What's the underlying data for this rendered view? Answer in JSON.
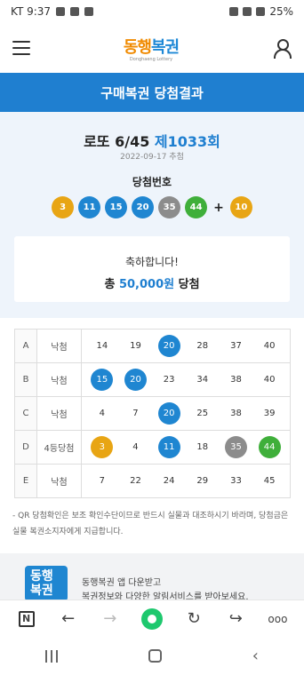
{
  "status_bar": {
    "carrier_time": "KT 9:37",
    "battery": "25%"
  },
  "header": {
    "logo_text_orange": "동행",
    "logo_text_blue": "복권",
    "logo_sub": "Donghaeng Lottery"
  },
  "page_title": "구매복권 당첨결과",
  "result": {
    "game": "로또 6/45",
    "round": "제1033회",
    "draw_date": "2022-09-17 추첨",
    "winning_label": "당첨번호",
    "winning_numbers": [
      {
        "n": "3",
        "color": "#e8a514"
      },
      {
        "n": "11",
        "color": "#1f86d1"
      },
      {
        "n": "15",
        "color": "#1f86d1"
      },
      {
        "n": "20",
        "color": "#1f86d1"
      },
      {
        "n": "35",
        "color": "#8c8c8c"
      },
      {
        "n": "44",
        "color": "#3faf3a"
      }
    ],
    "bonus_sign": "+",
    "bonus": {
      "n": "10",
      "color": "#e8a514"
    },
    "congrats": "축하합니다!",
    "total_prefix": "총",
    "total_amount": "50,000원",
    "total_suffix": "당첨"
  },
  "tickets": [
    {
      "game": "A",
      "rank": "낙첨",
      "numbers": [
        "14",
        "19",
        "20",
        "28",
        "37",
        "40"
      ],
      "hit": [
        false,
        false,
        "#1f86d1",
        false,
        false,
        false
      ]
    },
    {
      "game": "B",
      "rank": "낙첨",
      "numbers": [
        "15",
        "20",
        "23",
        "34",
        "38",
        "40"
      ],
      "hit": [
        "#1f86d1",
        "#1f86d1",
        false,
        false,
        false,
        false
      ]
    },
    {
      "game": "C",
      "rank": "낙첨",
      "numbers": [
        "4",
        "7",
        "20",
        "25",
        "38",
        "39"
      ],
      "hit": [
        false,
        false,
        "#1f86d1",
        false,
        false,
        false
      ]
    },
    {
      "game": "D",
      "rank": "4등당첨",
      "numbers": [
        "3",
        "4",
        "11",
        "18",
        "35",
        "44"
      ],
      "hit": [
        "#e8a514",
        false,
        "#1f86d1",
        false,
        "#8c8c8c",
        "#3faf3a"
      ]
    },
    {
      "game": "E",
      "rank": "낙첨",
      "numbers": [
        "7",
        "22",
        "24",
        "29",
        "33",
        "45"
      ],
      "hit": [
        false,
        false,
        false,
        false,
        false,
        false
      ]
    }
  ],
  "notice": "- QR 당첨확인은 보조 확인수단이므로 반드시 실물과 대조하시기 바라며, 당첨금은 실물 복권소지자에게 지급합니다.",
  "promo": {
    "logo_line1": "동행",
    "logo_line2": "복권",
    "line1": "동행복권 앱 다운받고",
    "line2": "복권정보와 다양한 알림서비스를 받아보세요."
  },
  "browser": {
    "naver_label": "N",
    "more_label": "ooo"
  }
}
